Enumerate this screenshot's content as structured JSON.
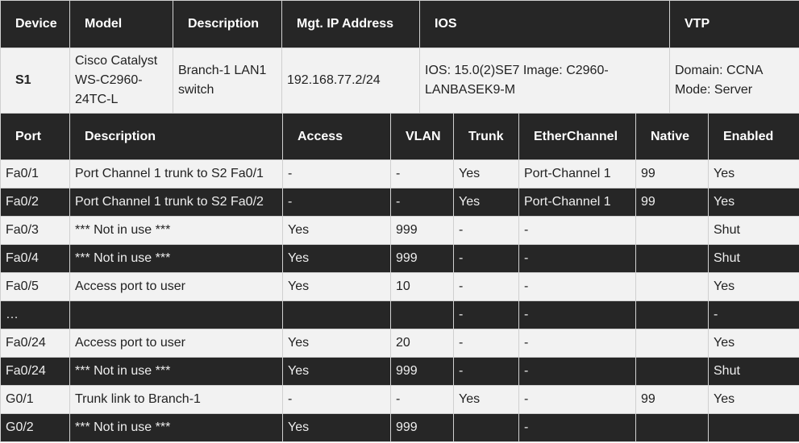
{
  "device_table": {
    "headers": [
      "Device",
      "Model",
      "Description",
      "Mgt. IP Address",
      "IOS",
      "VTP"
    ],
    "row": {
      "device": "S1",
      "model": "Cisco Catalyst WS-C2960-24TC-L",
      "description": "Branch-1 LAN1 switch",
      "mgt_ip": "192.168.77.2/24",
      "ios": "IOS: 15.0(2)SE7 Image: C2960-LANBASEK9-M",
      "vtp_domain": "Domain: CCNA",
      "vtp_mode": "Mode: Server"
    }
  },
  "port_table": {
    "headers": [
      "Port",
      "Description",
      "Access",
      "VLAN",
      "Trunk",
      "EtherChannel",
      "Native",
      "Enabled"
    ],
    "rows": [
      [
        "Fa0/1",
        "Port Channel 1 trunk to S2 Fa0/1",
        "-",
        "-",
        "Yes",
        "Port-Channel 1",
        "99",
        "Yes"
      ],
      [
        "Fa0/2",
        "Port Channel 1 trunk to S2 Fa0/2",
        "-",
        "-",
        "Yes",
        "Port-Channel 1",
        "99",
        "Yes"
      ],
      [
        "Fa0/3",
        "*** Not in use ***",
        "Yes",
        "999",
        "-",
        "-",
        "",
        "Shut"
      ],
      [
        "Fa0/4",
        "*** Not in use ***",
        "Yes",
        "999",
        "-",
        "-",
        "",
        "Shut"
      ],
      [
        "Fa0/5",
        "Access port to user",
        "Yes",
        "10",
        "-",
        "-",
        "",
        "Yes"
      ],
      [
        "…",
        "",
        "",
        "",
        "-",
        "-",
        "",
        "-"
      ],
      [
        "Fa0/24",
        "Access port to user",
        "Yes",
        "20",
        "-",
        "-",
        "",
        "Yes"
      ],
      [
        "Fa0/24",
        "*** Not in use ***",
        "Yes",
        "999",
        "-",
        "-",
        "",
        "Shut"
      ],
      [
        "G0/1",
        "Trunk link to Branch-1",
        "-",
        "-",
        "Yes",
        "-",
        "99",
        "Yes"
      ],
      [
        "G0/2",
        "*** Not in use ***",
        "Yes",
        "999",
        "",
        "-",
        "",
        ""
      ]
    ]
  },
  "colors": {
    "header_bg": "#262626",
    "light_row": "#f2f2f2",
    "dark_row": "#262626"
  }
}
